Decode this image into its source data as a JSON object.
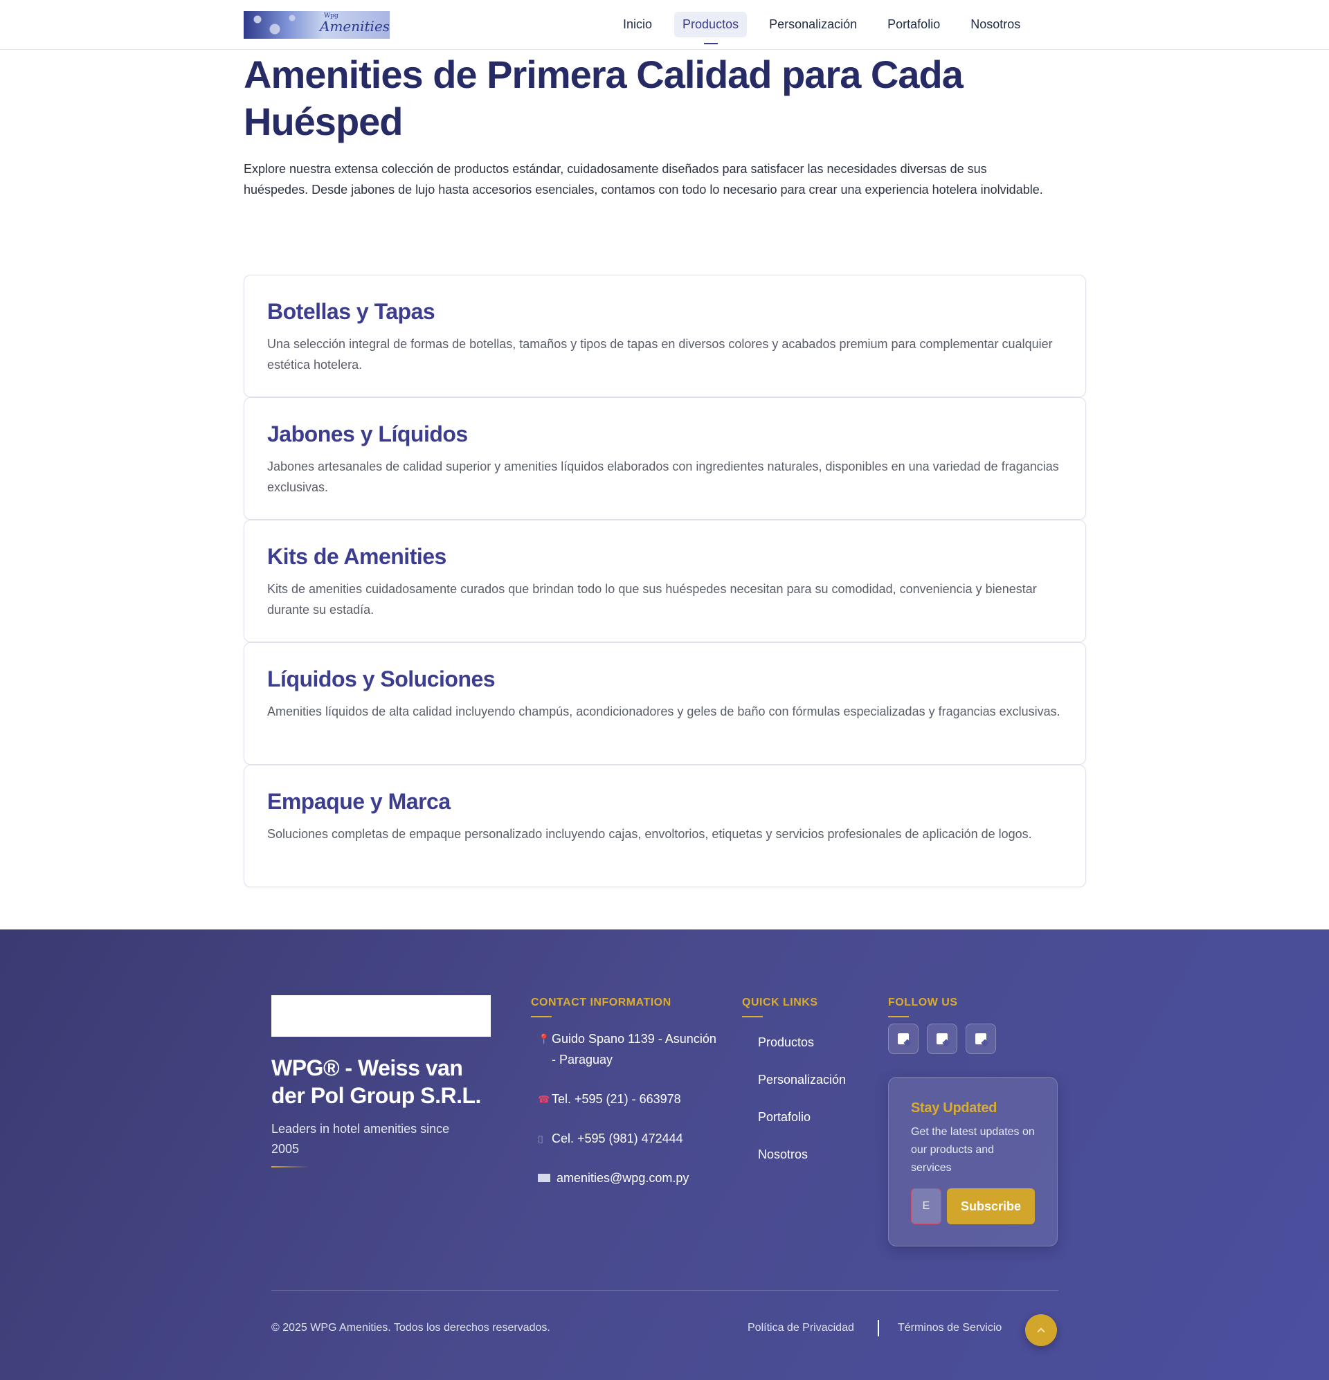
{
  "header": {
    "logo": {
      "small": "Wpg",
      "text": "Amenities"
    },
    "nav": [
      {
        "label": "Inicio",
        "active": false
      },
      {
        "label": "Productos",
        "active": true
      },
      {
        "label": "Personalización",
        "active": false
      },
      {
        "label": "Portafolio",
        "active": false
      },
      {
        "label": "Nosotros",
        "active": false
      }
    ]
  },
  "hero": {
    "title": "Amenities de Primera Calidad para Cada Huésped",
    "description": "Explore nuestra extensa colección de productos estándar, cuidadosamente diseñados para satisfacer las necesidades diversas de sus huéspedes. Desde jabones de lujo hasta accesorios esenciales, contamos con todo lo necesario para crear una experiencia hotelera inolvidable."
  },
  "categories": [
    {
      "title": "Botellas y Tapas",
      "description": "Una selección integral de formas de botellas, tamaños y tipos de tapas en diversos colores y acabados premium para complementar cualquier estética hotelera."
    },
    {
      "title": "Jabones y Líquidos",
      "description": "Jabones artesanales de calidad superior y amenities líquidos elaborados con ingredientes naturales, disponibles en una variedad de fragancias exclusivas."
    },
    {
      "title": "Kits de Amenities",
      "description": "Kits de amenities cuidadosamente curados que brindan todo lo que sus huéspedes necesitan para su comodidad, conveniencia y bienestar durante su estadía."
    },
    {
      "title": "Líquidos y Soluciones",
      "description": "Amenities líquidos de alta calidad incluyendo champús, acondicionadores y geles de baño con fórmulas especializadas y fragancias exclusivas."
    },
    {
      "title": "Empaque y Marca",
      "description": "Soluciones completas de empaque personalizado incluyendo cajas, envoltorios, etiquetas y servicios profesionales de aplicación de logos."
    }
  ],
  "footer": {
    "company": "WPG® - Weiss van der Pol Group S.R.L.",
    "tagline": "Leaders in hotel amenities since 2005",
    "contact_heading": "CONTACT INFORMATION",
    "contact": {
      "address": "Guido Spano 1139 - Asunción - Paraguay",
      "phone": "Tel. +595 (21) - 663978",
      "mobile": "Cel. +595 (981) 472444",
      "email": "amenities@wpg.com.py"
    },
    "quick_heading": "QUICK LINKS",
    "quick_links": [
      "Productos",
      "Personalización",
      "Portafolio",
      "Nosotros"
    ],
    "follow_heading": "FOLLOW US",
    "newsletter": {
      "title": "Stay Updated",
      "text": "Get the latest updates on our products and services",
      "input_value": "E",
      "button": "Subscribe"
    },
    "copyright": "© 2025 WPG Amenities. Todos los derechos reservados.",
    "privacy": "Política de Privacidad",
    "terms": "Términos de Servicio"
  },
  "colors": {
    "primary": "#3d3d8f",
    "heading": "#262b66",
    "accent_gold": "#d2a62a",
    "footer_bg": "#45468a"
  }
}
